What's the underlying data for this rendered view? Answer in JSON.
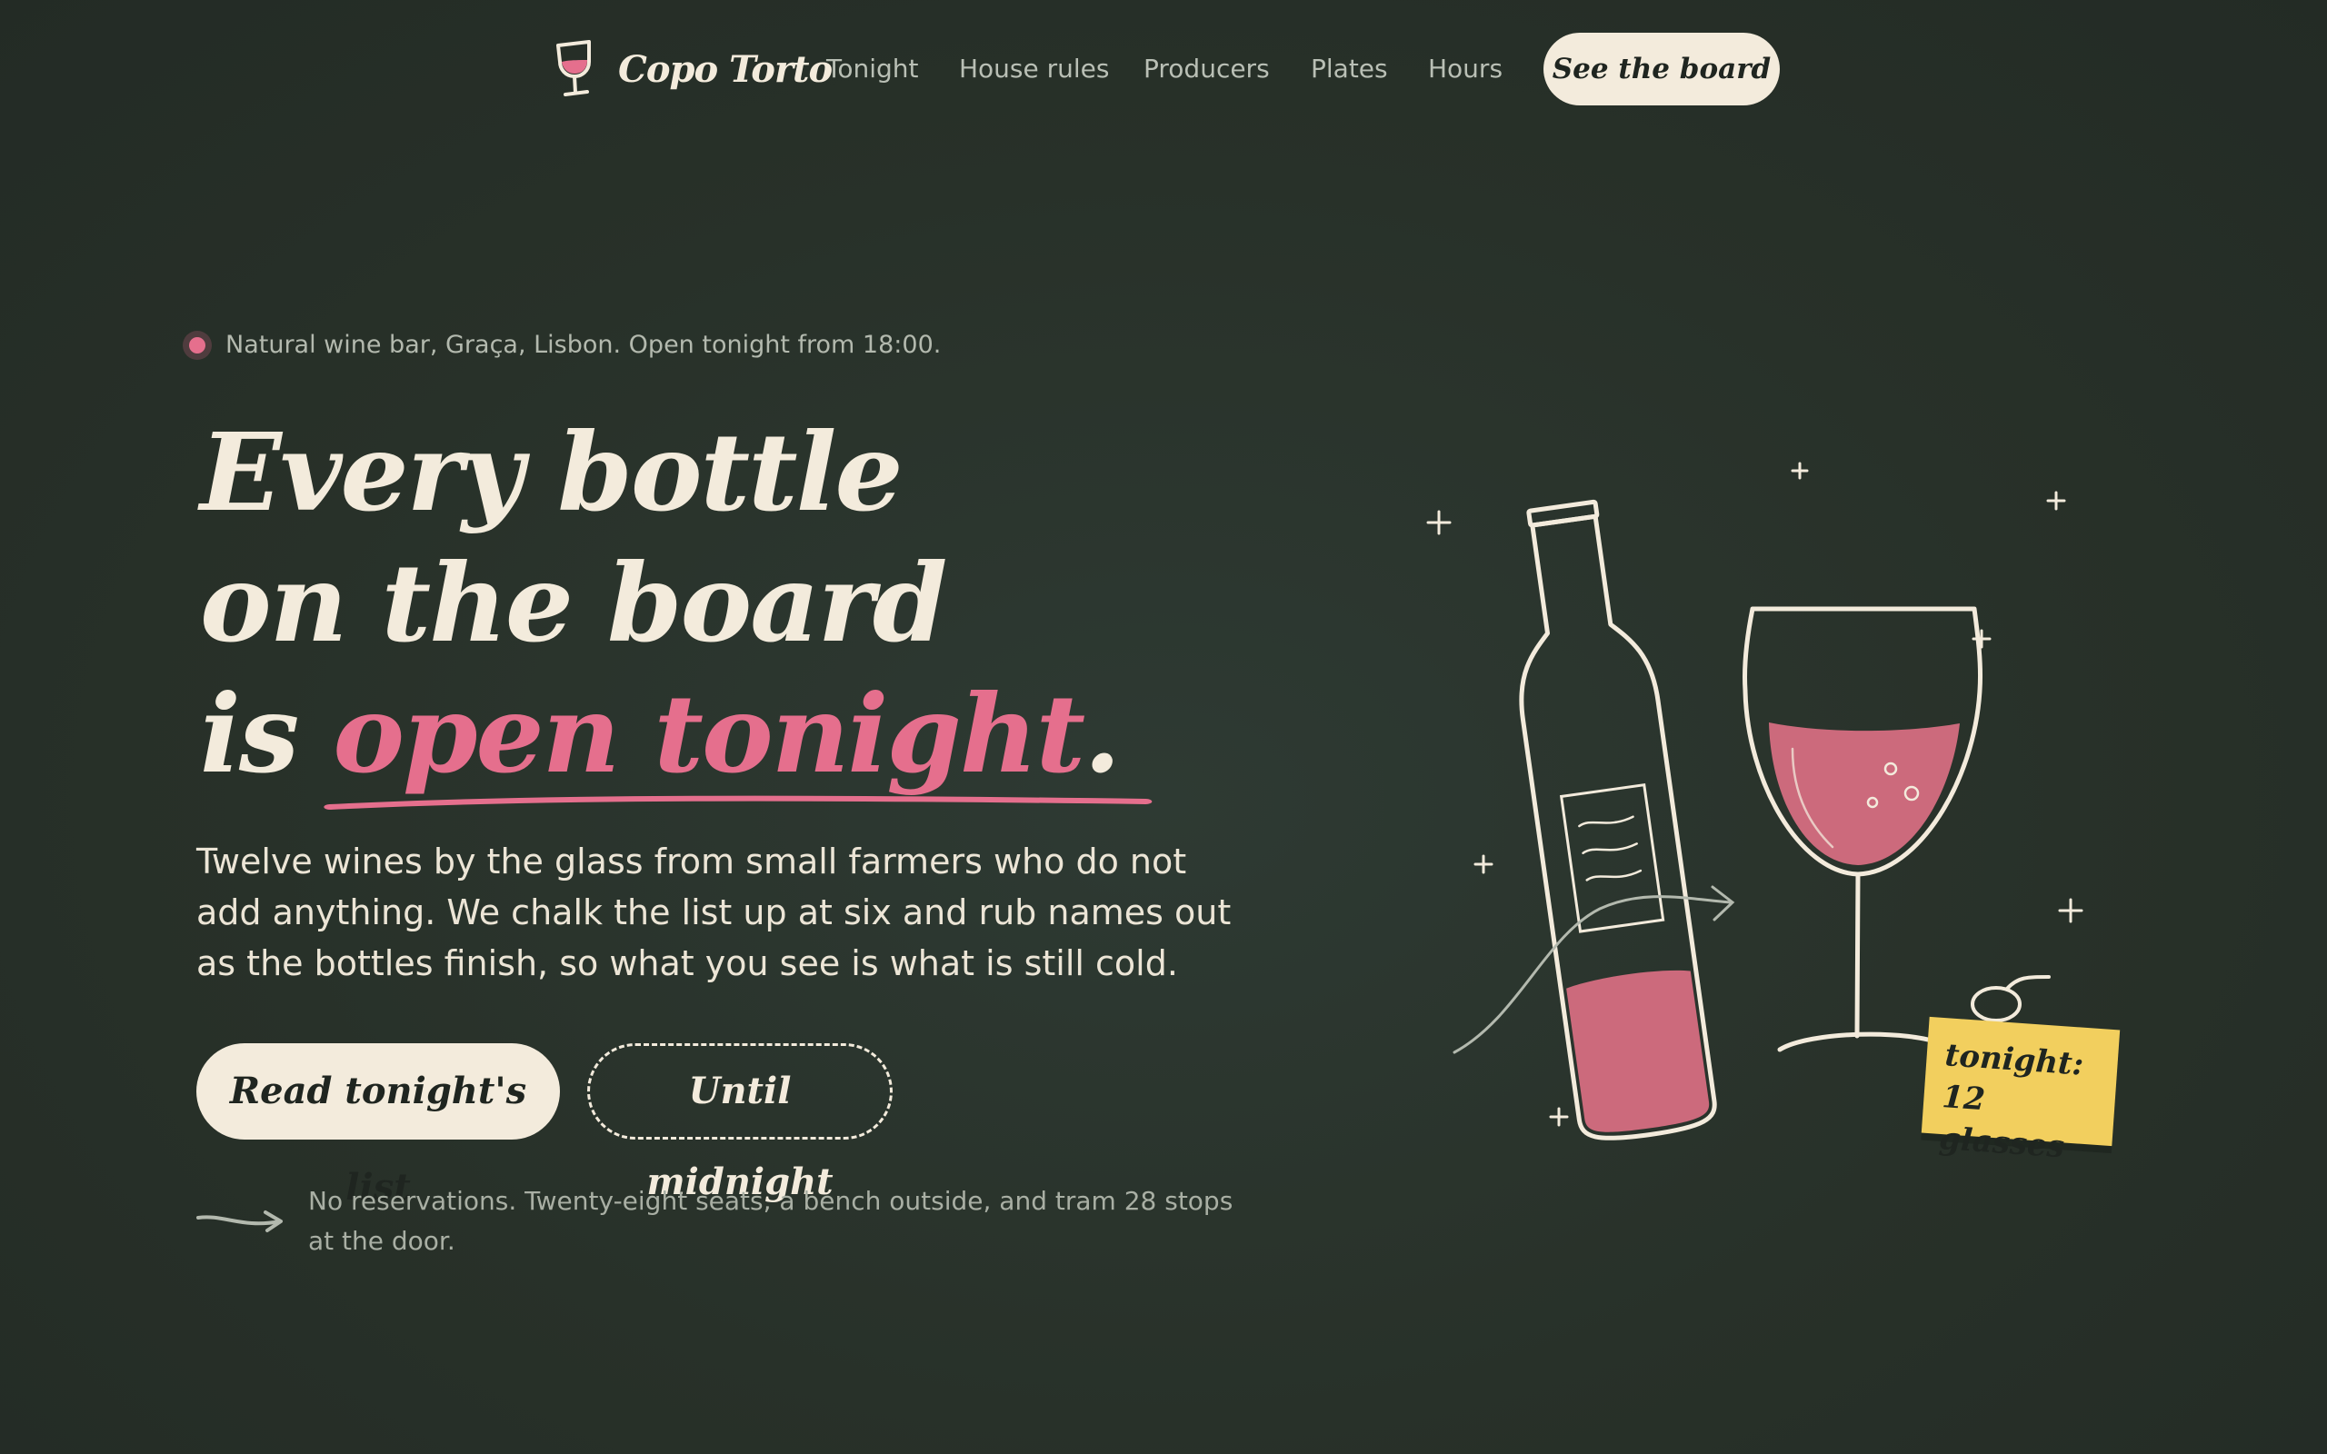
{
  "nav": {
    "brand": "Copo Torto",
    "links": [
      {
        "label": "Tonight"
      },
      {
        "label": "House rules"
      },
      {
        "label": "Producers"
      },
      {
        "label": "Plates"
      },
      {
        "label": "Hours"
      }
    ],
    "cta": "See the board"
  },
  "hero": {
    "status": "Natural wine bar, Graça, Lisbon. Open tonight from 18:00.",
    "headline": {
      "line1": "Every bottle",
      "line2": "on the board",
      "line3_prefix": "is ",
      "line3_accent": "open tonight",
      "line3_suffix": "."
    },
    "lede": "Twelve wines by the glass from small farmers who do not add anything. We chalk the list up at six and rub names out as the bottles finish, so what you see is what is still cold.",
    "primary_button": "Read tonight's list",
    "secondary_button": "Until midnight",
    "footnote": "No reservations. Twenty-eight seats, a bench outside, and tram 28 stops at the door."
  },
  "illustration": {
    "note_line1": "tonight:",
    "note_line2": "12 glasses"
  },
  "colors": {
    "background": "#283229",
    "chalk": "#f3ebdc",
    "wine": "#e56f8d",
    "note": "#f2cf5e",
    "muted": "#b3b9ae"
  },
  "icons": {
    "brand": "wine-glass-icon",
    "status": "status-dot",
    "footnote": "arrow-right-icon"
  }
}
